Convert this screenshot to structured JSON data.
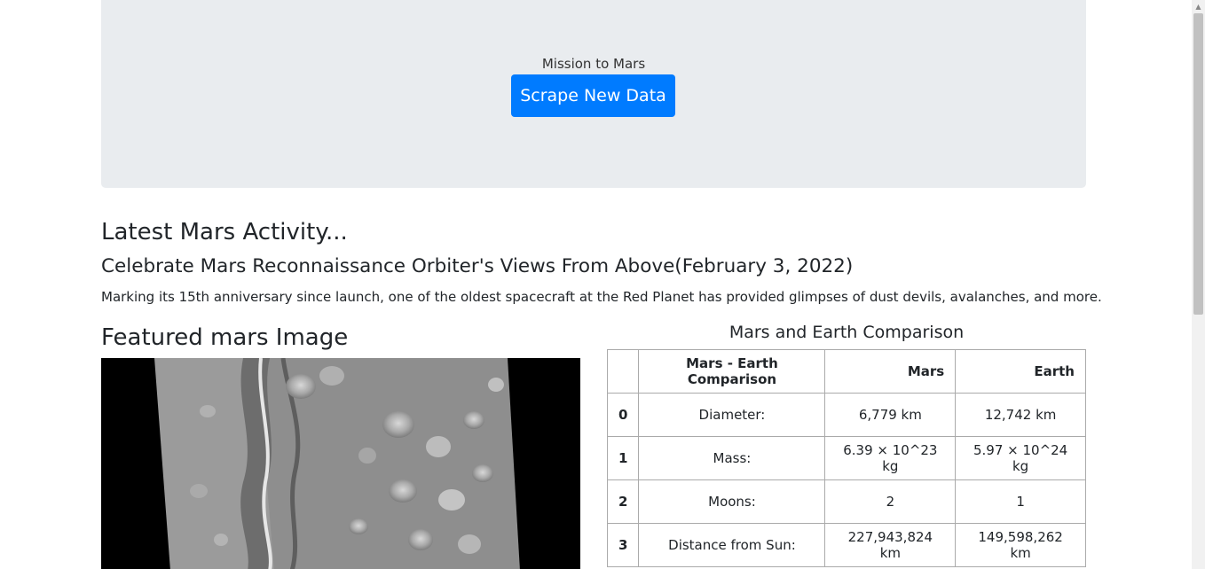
{
  "jumbotron": {
    "title": "Mission to Mars",
    "button_label": "Scrape New Data"
  },
  "news": {
    "section_title": "Latest Mars Activity...",
    "headline": "Celebrate Mars Reconnaissance Orbiter's Views From Above(February 3, 2022)",
    "teaser": "Marking its 15th anniversary since launch, one of the oldest spacecraft at the Red Planet has provided glimpses of dust devils, avalanches, and more."
  },
  "featured": {
    "title": "Featured mars Image"
  },
  "facts_table": {
    "caption": "Mars and Earth Comparison",
    "headers": [
      "",
      "Mars - Earth Comparison",
      "Mars",
      "Earth"
    ],
    "rows": [
      {
        "index": "0",
        "label": "Diameter:",
        "mars": "6,779 km",
        "earth": "12,742 km"
      },
      {
        "index": "1",
        "label": "Mass:",
        "mars": "6.39 × 10^23 kg",
        "earth": "5.97 × 10^24 kg"
      },
      {
        "index": "2",
        "label": "Moons:",
        "mars": "2",
        "earth": "1"
      },
      {
        "index": "3",
        "label": "Distance from Sun:",
        "mars": "227,943,824 km",
        "earth": "149,598,262 km"
      }
    ]
  },
  "colors": {
    "accent": "#007bff",
    "jumbotron_bg": "#e9ecef"
  }
}
